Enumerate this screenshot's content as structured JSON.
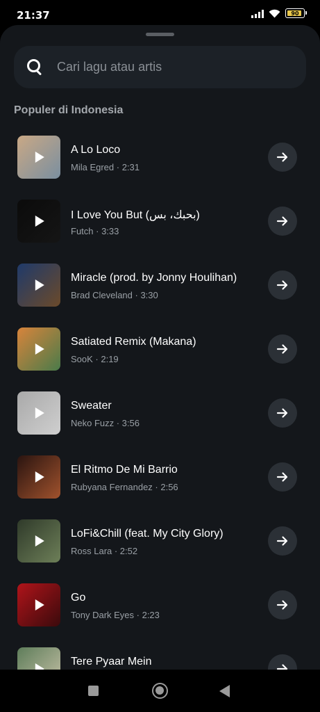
{
  "status_bar": {
    "time": "21:37",
    "battery": "90",
    "battery_level": 0.9
  },
  "search": {
    "placeholder": "Cari lagu atau artis",
    "value": ""
  },
  "section": {
    "title": "Populer di Indonesia"
  },
  "songs": [
    {
      "title": "A Lo Loco",
      "meta": "Mila Egred · 2:31",
      "cover_colors": [
        "#c9a885",
        "#7a8fa0"
      ]
    },
    {
      "title": "I Love You But (بحبك، بس)",
      "meta": "Futch · 3:33",
      "cover_colors": [
        "#0b0b0b",
        "#151515"
      ]
    },
    {
      "title": "Miracle (prod. by Jonny Houlihan)",
      "meta": "Brad Cleveland · 3:30",
      "cover_colors": [
        "#1f3a6a",
        "#6b4a2a"
      ]
    },
    {
      "title": "Satiated Remix (Makana)",
      "meta": "SooK · 2:19",
      "cover_colors": [
        "#d8843b",
        "#4a7b4a"
      ]
    },
    {
      "title": "Sweater",
      "meta": "Neko Fuzz · 3:56",
      "cover_colors": [
        "#a9a9a9",
        "#cfcfcf"
      ]
    },
    {
      "title": "El Ritmo De Mi Barrio",
      "meta": "Rubyana Fernandez · 2:56",
      "cover_colors": [
        "#2a1410",
        "#a0522d"
      ]
    },
    {
      "title": "LoFi&Chill (feat. My City Glory)",
      "meta": "Ross Lara · 2:52",
      "cover_colors": [
        "#2f3a2a",
        "#6d7f58"
      ]
    },
    {
      "title": "Go",
      "meta": "Tony Dark Eyes · 2:23",
      "cover_colors": [
        "#b0141a",
        "#3a0a0c"
      ]
    },
    {
      "title": "Tere Pyaar Mein",
      "meta": "",
      "cover_colors": [
        "#5e7d5a",
        "#c8c2a8"
      ]
    }
  ]
}
